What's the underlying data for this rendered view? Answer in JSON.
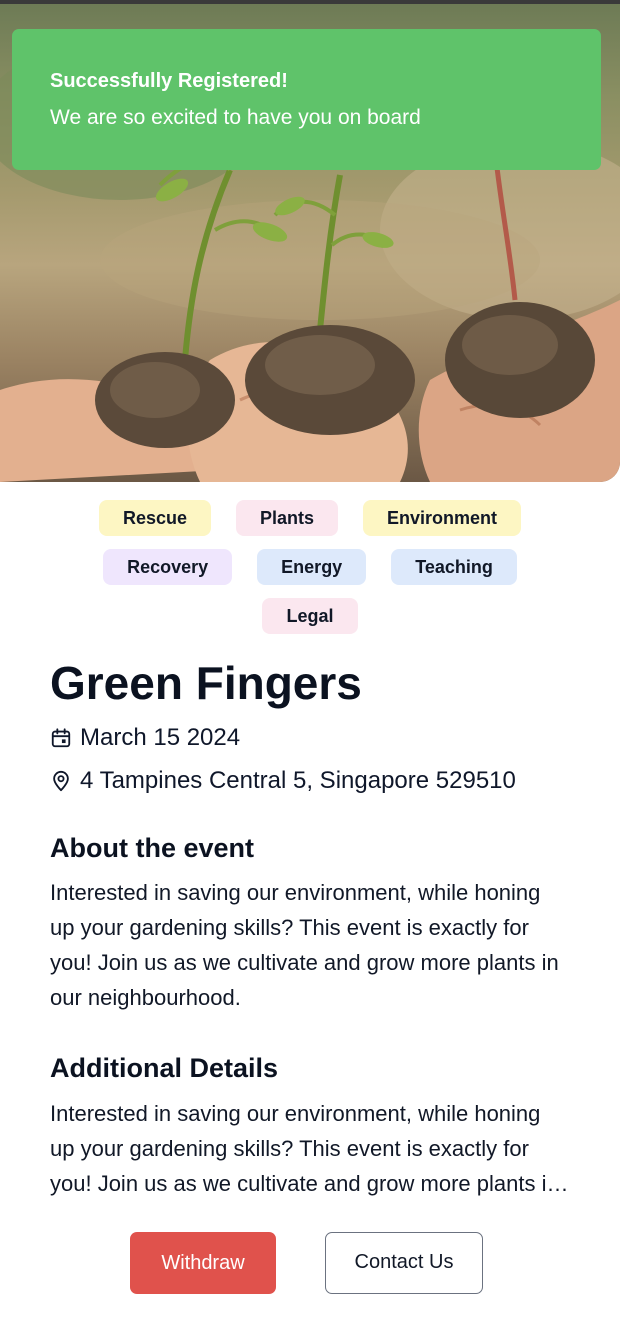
{
  "toast": {
    "title": "Successfully Registered!",
    "message": "We are so excited to have you on board"
  },
  "tags": [
    {
      "label": "Rescue",
      "color": "#fdf6c3"
    },
    {
      "label": "Plants",
      "color": "#fbe7ef"
    },
    {
      "label": "Environment",
      "color": "#fdf6c3"
    },
    {
      "label": "Recovery",
      "color": "#efe6fd"
    },
    {
      "label": "Energy",
      "color": "#dde9fb"
    },
    {
      "label": "Teaching",
      "color": "#dde9fb"
    },
    {
      "label": "Legal",
      "color": "#fbe7ef"
    }
  ],
  "event": {
    "title": "Green Fingers",
    "date": "March 15 2024",
    "location": "4 Tampines Central 5, Singapore 529510"
  },
  "about": {
    "heading": "About the event",
    "body": "Interested in saving our environment, while honing up your gardening skills? This event is exactly for you! Join us as we cultivate and grow more plants in our neighbourhood."
  },
  "additional": {
    "heading": "Additional Details",
    "body": "Interested in saving our environment, while honing up your gardening skills? This event is exactly for you! Join us as we cultivate and grow more plants in our neighbourhood."
  },
  "actions": {
    "withdraw_label": "Withdraw",
    "contact_label": "Contact Us"
  },
  "colors": {
    "toast": "#5fc36a",
    "withdraw": "#e0524c",
    "text": "#0f172a"
  }
}
